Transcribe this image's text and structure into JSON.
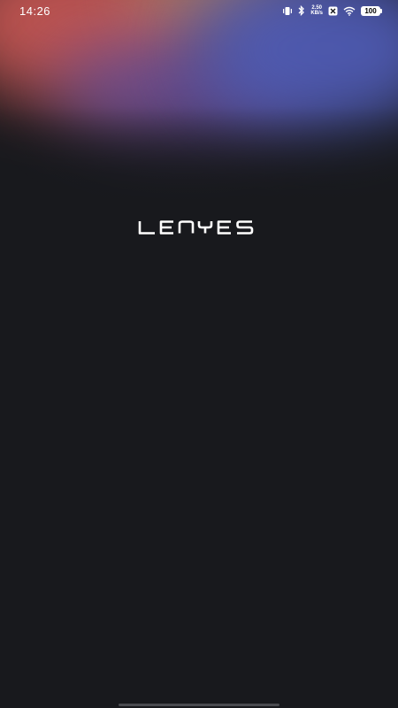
{
  "status_bar": {
    "time": "14:26",
    "net_speed_value": "2.50",
    "net_speed_unit": "KB/s",
    "battery_level": "100",
    "icons": [
      "vibrate-icon",
      "bluetooth-icon",
      "net-speed-indicator",
      "notification-icon",
      "wifi-icon",
      "battery-icon"
    ]
  },
  "brand": {
    "logo_text": "LENYES"
  },
  "colors": {
    "background": "#18191d",
    "glow_red": "#c45652",
    "glow_blue": "#4f5bb3",
    "glow_violet": "#6a4f9a",
    "text": "#ffffff"
  }
}
